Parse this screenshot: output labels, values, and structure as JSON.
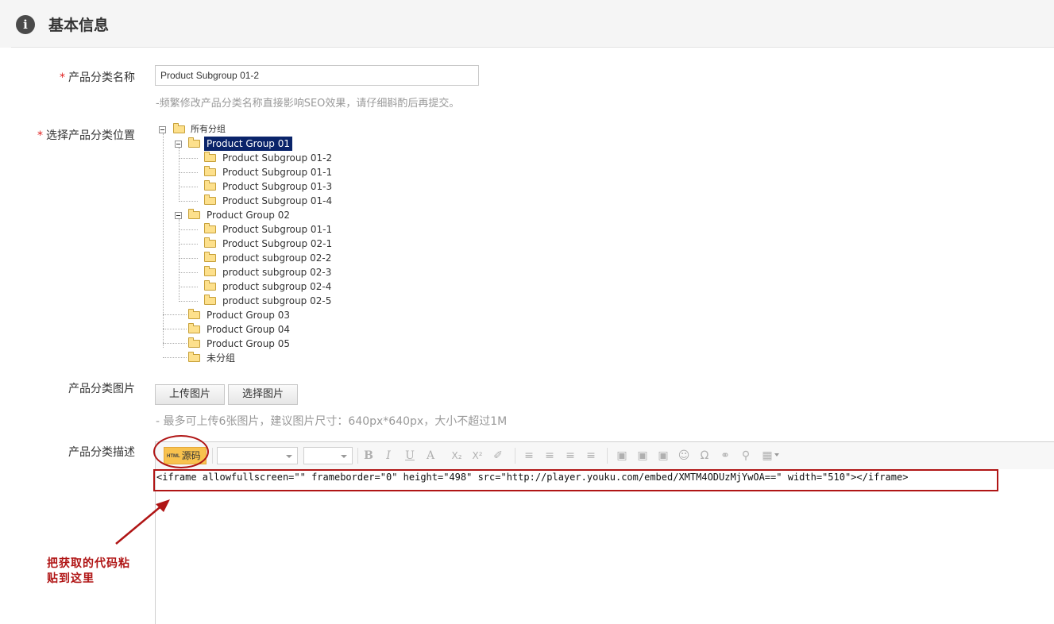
{
  "header": {
    "title": "基本信息",
    "icon": "info-icon"
  },
  "name_field": {
    "label": "产品分类名称",
    "required_mark": "*",
    "value": "Product Subgroup 01-2",
    "hint": "-频繁修改产品分类名称直接影响SEO效果，请仔细斟酌后再提交。"
  },
  "position_field": {
    "label": "选择产品分类位置",
    "required_mark": "*",
    "tree": {
      "root": "所有分组",
      "groups": [
        {
          "label": "Product Group 01",
          "selected": true,
          "expanded": true,
          "children": [
            "Product Subgroup 01-2",
            "Product Subgroup 01-1",
            "Product Subgroup 01-3",
            "Product Subgroup 01-4"
          ]
        },
        {
          "label": "Product Group 02",
          "selected": false,
          "expanded": true,
          "children": [
            "Product Subgroup 01-1",
            "Product Subgroup 02-1",
            "product subgroup 02-2",
            "product subgroup 02-3",
            "product subgroup 02-4",
            "product subgroup 02-5"
          ]
        },
        {
          "label": "Product Group 03"
        },
        {
          "label": "Product Group 04"
        },
        {
          "label": "Product Group 05"
        },
        {
          "label": "未分组"
        }
      ]
    }
  },
  "image_field": {
    "label": "产品分类图片",
    "upload_button": "上传图片",
    "select_button": "选择图片",
    "hint": "- 最多可上传6张图片，建议图片尺寸：640px*640px，大小不超过1M"
  },
  "desc_field": {
    "label": "产品分类描述",
    "source_button": "源码",
    "source_button_tag": "HTML",
    "content": "<iframe allowfullscreen=\"\" frameborder=\"0\" height=\"498\" src=\"http://player.youku.com/embed/XMTM4ODUzMjYwOA==\" width=\"510\"></iframe>",
    "toolbar_icons": [
      "B",
      "I",
      "U",
      "A",
      "X₂",
      "X²",
      "✐",
      "≡",
      "≡",
      "≡",
      "≡",
      "▣",
      "▣",
      "▣",
      "☺",
      "Ω",
      "⚭",
      "⚲",
      "▦"
    ]
  },
  "annotation": {
    "note": "把获取的代码粘贴到这里",
    "line1": "把获取的代码粘",
    "line2": "贴到这里",
    "color": "#b01515"
  }
}
